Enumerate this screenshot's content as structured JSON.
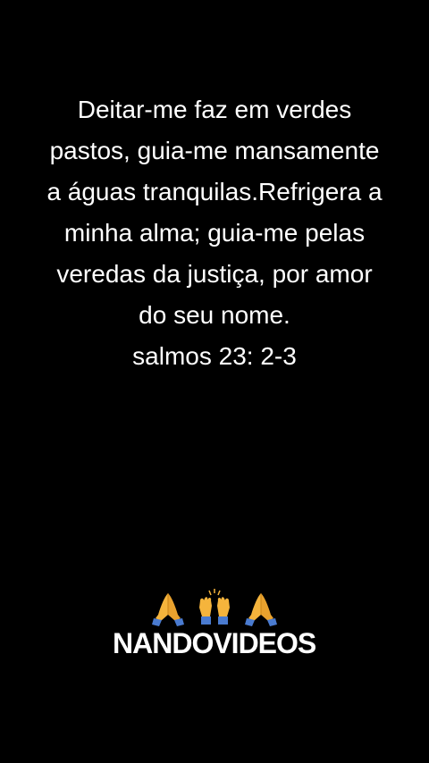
{
  "verse": {
    "lines": [
      "Deitar-me faz em verdes",
      "pastos, guia-me mansamente",
      "a águas tranquilas.Refrigera a",
      "minha alma; guia-me pelas",
      "veredas da justiça, por amor",
      "do seu nome.",
      "salmos 23: 2-3"
    ]
  },
  "emojis": {
    "items": [
      "praying-hands-icon",
      "raising-hands-icon",
      "praying-hands-icon"
    ],
    "skin_color": "#F5B43C",
    "cuff_color": "#4A7BD0"
  },
  "watermark": {
    "text": "NANDOVIDEOS"
  },
  "colors": {
    "background": "#000000",
    "text": "#FFFFFF"
  }
}
